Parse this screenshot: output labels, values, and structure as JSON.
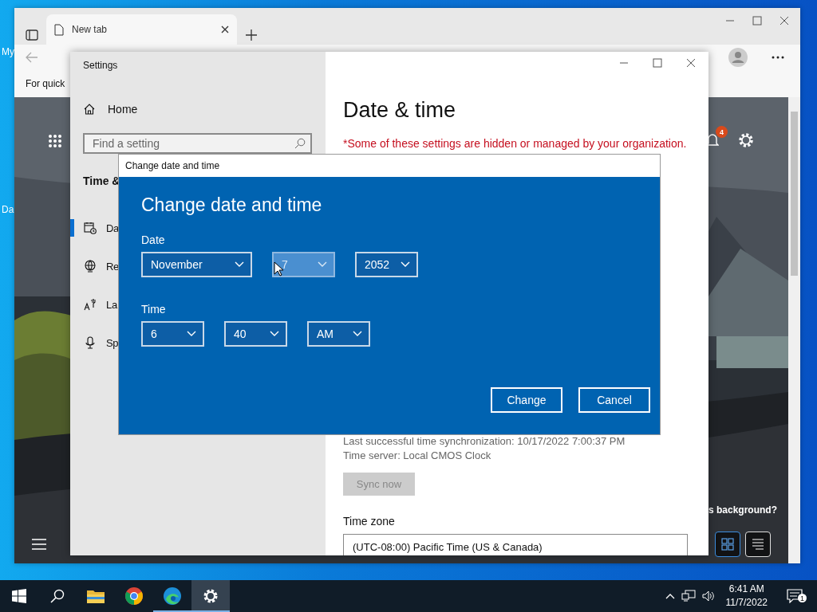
{
  "desktop": {
    "icons": [
      {
        "label": "My"
      },
      {
        "label": "Da"
      }
    ]
  },
  "browser": {
    "tabs": [
      {
        "label": "New tab",
        "selected": true
      }
    ],
    "bookmarks_hint": "For quick",
    "feed": {
      "notification_count": "4",
      "caption": "s background?",
      "layout_buttons": [
        {
          "kind": "grid",
          "selected": true
        },
        {
          "kind": "list",
          "selected": false
        }
      ]
    }
  },
  "settings": {
    "title": "Settings",
    "home": "Home",
    "search": {
      "placeholder": "Find a setting"
    },
    "section": "Time &",
    "nav": [
      {
        "kind": "calendar",
        "label": "Da",
        "selected": true
      },
      {
        "kind": "globe",
        "label": "Re",
        "selected": false
      },
      {
        "kind": "language",
        "label": "La",
        "selected": false
      },
      {
        "kind": "microphone",
        "label": "Sp",
        "selected": false
      }
    ],
    "page": {
      "title": "Date & time",
      "notice": "*Some of these settings are hidden or managed by your organization.",
      "sync_info": [
        "Last successful time synchronization: 10/17/2022 7:00:37 PM",
        "Time server: Local CMOS Clock"
      ],
      "sync_button": {
        "label": "Sync now",
        "disabled": true
      },
      "time_zone": {
        "label": "Time zone",
        "value": "(UTC-08:00) Pacific Time (US & Canada)"
      }
    }
  },
  "dialog": {
    "window_title": "Change date and time",
    "heading": "Change date and time",
    "date": {
      "label": "Date",
      "fields": [
        {
          "value": "November",
          "hovered": false
        },
        {
          "value": "7",
          "hovered": true
        },
        {
          "value": "2052",
          "hovered": false
        }
      ]
    },
    "time": {
      "label": "Time",
      "fields": [
        {
          "value": "6",
          "hovered": false
        },
        {
          "value": "40",
          "hovered": false
        },
        {
          "value": "AM",
          "hovered": false
        }
      ]
    },
    "buttons": [
      {
        "label": "Change"
      },
      {
        "label": "Cancel"
      }
    ]
  },
  "taskbar": {
    "apps": [
      {
        "kind": "explorer",
        "running": false,
        "selected": false
      },
      {
        "kind": "chrome",
        "running": false,
        "selected": false
      },
      {
        "kind": "edge",
        "running": true,
        "selected": false
      },
      {
        "kind": "settings",
        "running": true,
        "selected": true
      }
    ],
    "time": "6:41 AM",
    "date": "11/7/2022",
    "notifications": "1"
  }
}
